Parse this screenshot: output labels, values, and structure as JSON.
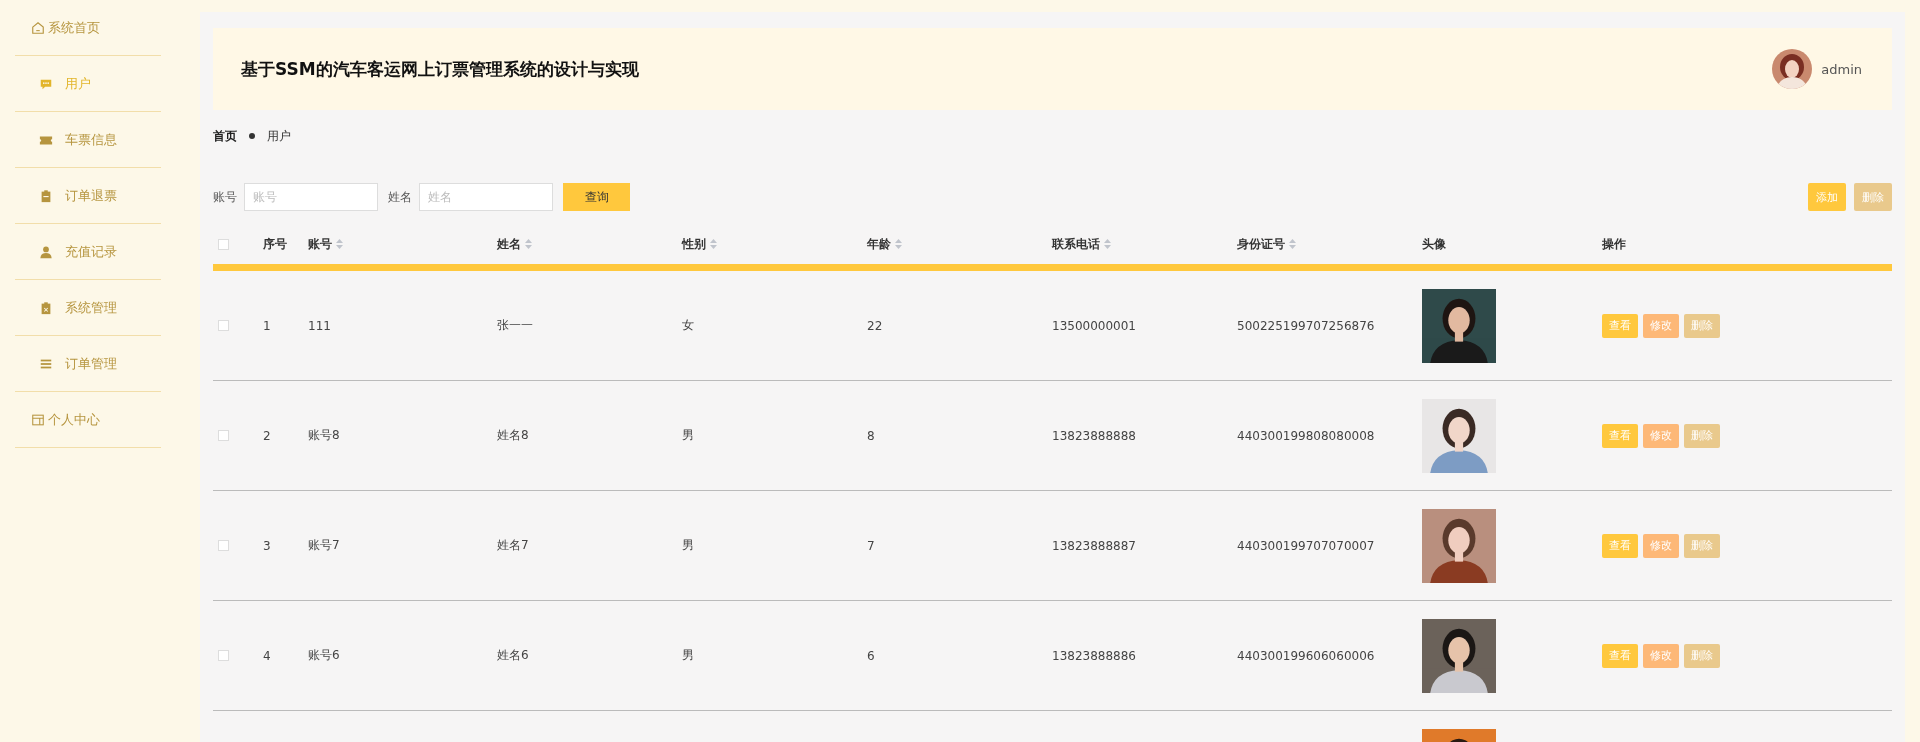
{
  "sidebar": {
    "items": [
      {
        "label": "系统首页",
        "kind": "top",
        "selected": false
      },
      {
        "label": "用户",
        "kind": "menu",
        "selected": true
      },
      {
        "label": "车票信息",
        "kind": "menu",
        "selected": false
      },
      {
        "label": "订单退票",
        "kind": "menu",
        "selected": false
      },
      {
        "label": "充值记录",
        "kind": "menu",
        "selected": false
      },
      {
        "label": "系统管理",
        "kind": "menu",
        "selected": false
      },
      {
        "label": "订单管理",
        "kind": "menu",
        "selected": false
      },
      {
        "label": "个人中心",
        "kind": "top",
        "selected": false
      }
    ]
  },
  "header": {
    "title": "基于SSM的汽车客运网上订票管理系统的设计与实现",
    "user": "admin"
  },
  "breadcrumb": [
    "首页",
    "用户"
  ],
  "search": {
    "fields": [
      {
        "label": "账号",
        "placeholder": "账号"
      },
      {
        "label": "姓名",
        "placeholder": "姓名"
      }
    ],
    "button": "查询"
  },
  "toolbar": [
    {
      "label": "添加",
      "kind": "add"
    },
    {
      "label": "删除",
      "kind": "delete"
    }
  ],
  "table": {
    "select_all": {
      "checked": false
    },
    "columns": [
      {
        "label": "序号",
        "sortable": false
      },
      {
        "label": "账号",
        "sortable": true
      },
      {
        "label": "姓名",
        "sortable": true
      },
      {
        "label": "性别",
        "sortable": true
      },
      {
        "label": "年龄",
        "sortable": true
      },
      {
        "label": "联系电话",
        "sortable": true
      },
      {
        "label": "身份证号",
        "sortable": true
      },
      {
        "label": "头像",
        "sortable": false
      },
      {
        "label": "操作",
        "sortable": false
      }
    ],
    "rows": [
      {
        "checked": false,
        "cells": [
          "1",
          "111",
          "张一一",
          "女",
          "22",
          "13500000001",
          "500225199707256876"
        ],
        "avatar": {
          "kind": "picture"
        },
        "actions": [
          {
            "label": "查看",
            "kind": "view"
          },
          {
            "label": "修改",
            "kind": "edit"
          },
          {
            "label": "删除",
            "kind": "delete"
          }
        ]
      },
      {
        "checked": false,
        "cells": [
          "2",
          "账号8",
          "姓名8",
          "男",
          "8",
          "13823888888",
          "440300199808080008"
        ],
        "avatar": {
          "kind": "picture"
        },
        "actions": [
          {
            "label": "查看",
            "kind": "view"
          },
          {
            "label": "修改",
            "kind": "edit"
          },
          {
            "label": "删除",
            "kind": "delete"
          }
        ]
      },
      {
        "checked": false,
        "cells": [
          "3",
          "账号7",
          "姓名7",
          "男",
          "7",
          "13823888887",
          "440300199707070007"
        ],
        "avatar": {
          "kind": "picture"
        },
        "actions": [
          {
            "label": "查看",
            "kind": "view"
          },
          {
            "label": "修改",
            "kind": "edit"
          },
          {
            "label": "删除",
            "kind": "delete"
          }
        ]
      },
      {
        "checked": false,
        "cells": [
          "4",
          "账号6",
          "姓名6",
          "男",
          "6",
          "13823888886",
          "440300199606060006"
        ],
        "avatar": {
          "kind": "picture"
        },
        "actions": [
          {
            "label": "查看",
            "kind": "view"
          },
          {
            "label": "修改",
            "kind": "edit"
          },
          {
            "label": "删除",
            "kind": "delete"
          }
        ]
      },
      {
        "avatar": {
          "kind": "picture"
        }
      }
    ]
  }
}
